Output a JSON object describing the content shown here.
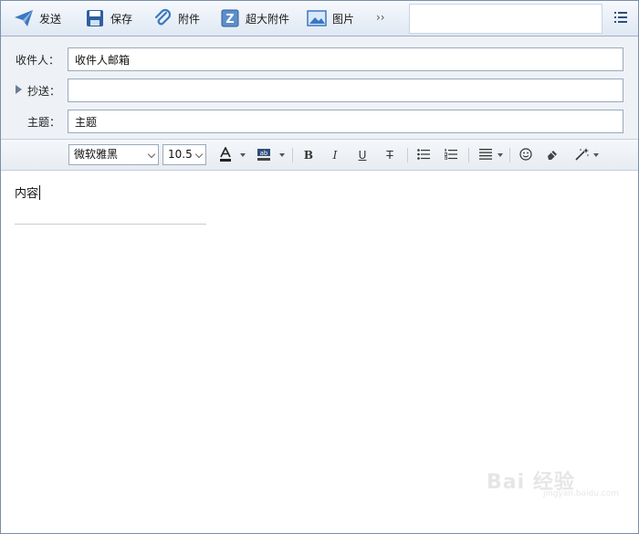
{
  "toolbar": {
    "send_label": "发送",
    "save_label": "保存",
    "attach_label": "附件",
    "big_attach_label": "超大附件",
    "image_label": "图片",
    "more_label": "››",
    "search_value": ""
  },
  "fields": {
    "to_label": "收件人：",
    "to_value": "收件人邮箱",
    "cc_label": "抄送：",
    "cc_value": "",
    "subject_label": "主题：",
    "subject_value": "主题"
  },
  "format": {
    "font_family": "微软雅黑",
    "font_size": "10.5",
    "bold": "B",
    "italic": "I",
    "underline": "U",
    "strike": "T"
  },
  "body": {
    "content": "内容"
  },
  "watermark": {
    "text": "Bai 经验",
    "sub": "jingyan.baidu.com"
  },
  "colors": {
    "accent": "#3a78c2",
    "toolbar_bg": "#e4ecf6"
  }
}
